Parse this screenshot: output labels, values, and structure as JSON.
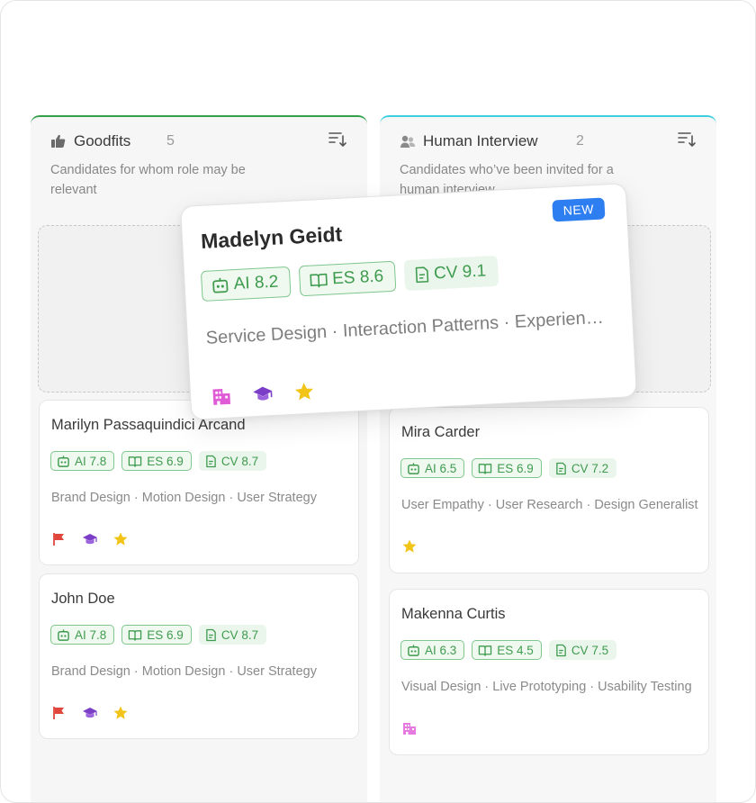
{
  "columns": [
    {
      "title": "Goodfits",
      "count": "5",
      "description": "Candidates for whom role may be relevant",
      "accent": "#35a04a",
      "cards": [
        {
          "name": "Marilyn Passaquindici Arcand",
          "ai": "AI 7.8",
          "es": "ES 6.9",
          "cv": "CV 8.7",
          "skills": "Brand Design · Motion Design · User Strategy",
          "tags": [
            "flag-icon",
            "graduation-cap-icon",
            "star-icon"
          ]
        },
        {
          "name": "John Doe",
          "ai": "AI 7.8",
          "es": "ES 6.9",
          "cv": "CV 8.7",
          "skills": "Brand Design · Motion Design · User Strategy",
          "tags": [
            "flag-icon",
            "graduation-cap-icon",
            "star-icon"
          ]
        }
      ]
    },
    {
      "title": "Human Interview",
      "count": "2",
      "description": "Candidates who’ve been invited for a human interview",
      "accent": "#3ccfe0",
      "cards": [
        {
          "name": "Mira Carder",
          "ai": "AI 6.5",
          "es": "ES 6.9",
          "cv": "CV 7.2",
          "skills": "User Empathy · User Research · Design Generalist",
          "tags": [
            "star-icon"
          ]
        },
        {
          "name": "Makenna Curtis",
          "ai": "AI 6.3",
          "es": "ES 4.5",
          "cv": "CV 7.5",
          "skills": "Visual Design · Live Prototyping · Usability Testing",
          "tags": [
            "building-icon"
          ]
        }
      ]
    }
  ],
  "dragged_card": {
    "badge": "NEW",
    "name": "Madelyn Geidt",
    "ai": "AI 8.2",
    "es": "ES 8.6",
    "cv": "CV 9.1",
    "skills": "Service Design · Interaction Patterns · Experience Strategy",
    "tags": [
      "building-icon",
      "graduation-cap-icon",
      "star-icon"
    ]
  },
  "colors": {
    "score_text": "#3f9b4e",
    "new_badge": "#2d7ef0",
    "goodfits_accent": "#35a04a",
    "interview_accent": "#3ccfe0"
  }
}
